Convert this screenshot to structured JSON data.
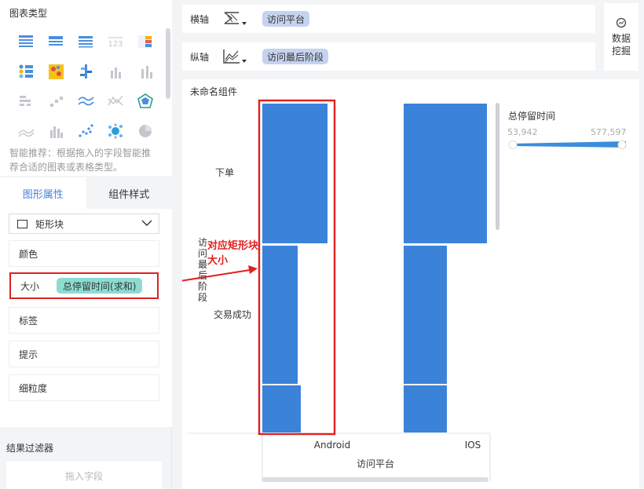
{
  "left_panel": {
    "chart_types_title": "图表类型",
    "chart_type_icons": [
      "table-icon",
      "cross-table-icon",
      "detail-table-icon",
      "kpi-number-icon",
      "color-table-icon",
      "dot-matrix-icon",
      "heatmap-icon",
      "color-bar-icon",
      "column-icon",
      "stacked-column-icon",
      "horizontal-bar-icon",
      "scatter-column-icon",
      "multi-line-icon",
      "line-compare-icon",
      "radar-icon",
      "area-icon",
      "grouped-column-icon",
      "scatter-icon",
      "bubble-icon",
      "pie-icon"
    ],
    "smart_hint": "智能推荐：根据拖入的字段智能推荐合适的图表或表格类型。",
    "tabs": [
      {
        "label": "图形属性",
        "active": true
      },
      {
        "label": "组件样式",
        "active": false
      }
    ],
    "shape_select": {
      "value": "矩形块"
    },
    "props": {
      "color_label": "颜色",
      "size_label": "大小",
      "size_field": "总停留时间(求和)",
      "label_label": "标签",
      "tooltip_label": "提示",
      "granularity_label": "细粒度"
    },
    "filter_title": "结果过滤器",
    "filter_placeholder": "拖入字段"
  },
  "axes": {
    "x_label": "横轴",
    "x_field": "访问平台",
    "y_label": "纵轴",
    "y_field": "访问最后阶段"
  },
  "mining_button": {
    "line1": "数据",
    "line2": "挖掘"
  },
  "chart_panel": {
    "title": "未命名组件",
    "legend": {
      "title": "总停留时间",
      "min": "53,942",
      "max": "577,597"
    },
    "annotation": "对应矩形块大小"
  },
  "colors": {
    "bar": "#3b82d9",
    "highlight": "#e02020",
    "pill_blue": "#c5d3ef",
    "pill_green": "#8cddd0",
    "active_tab": "#4a80d9"
  },
  "chart_data": {
    "type": "bar",
    "title": "",
    "xlabel": "访问平台",
    "ylabel": "访问最后阶段",
    "categories": [
      "Android",
      "IOS"
    ],
    "row_labels": [
      "下单",
      "交易成功"
    ],
    "size_field": "总停留时间",
    "size_range": [
      53942,
      577597
    ],
    "cells": [
      {
        "x": "Android",
        "size_share": 0.78
      },
      {
        "x": "Android",
        "size_share": 0.42
      },
      {
        "x": "Android",
        "size_share": 0.46
      },
      {
        "x": "IOS",
        "size_share": 1.0
      },
      {
        "x": "IOS",
        "size_share": 0.52
      },
      {
        "x": "IOS",
        "size_share": 0.52
      }
    ]
  }
}
